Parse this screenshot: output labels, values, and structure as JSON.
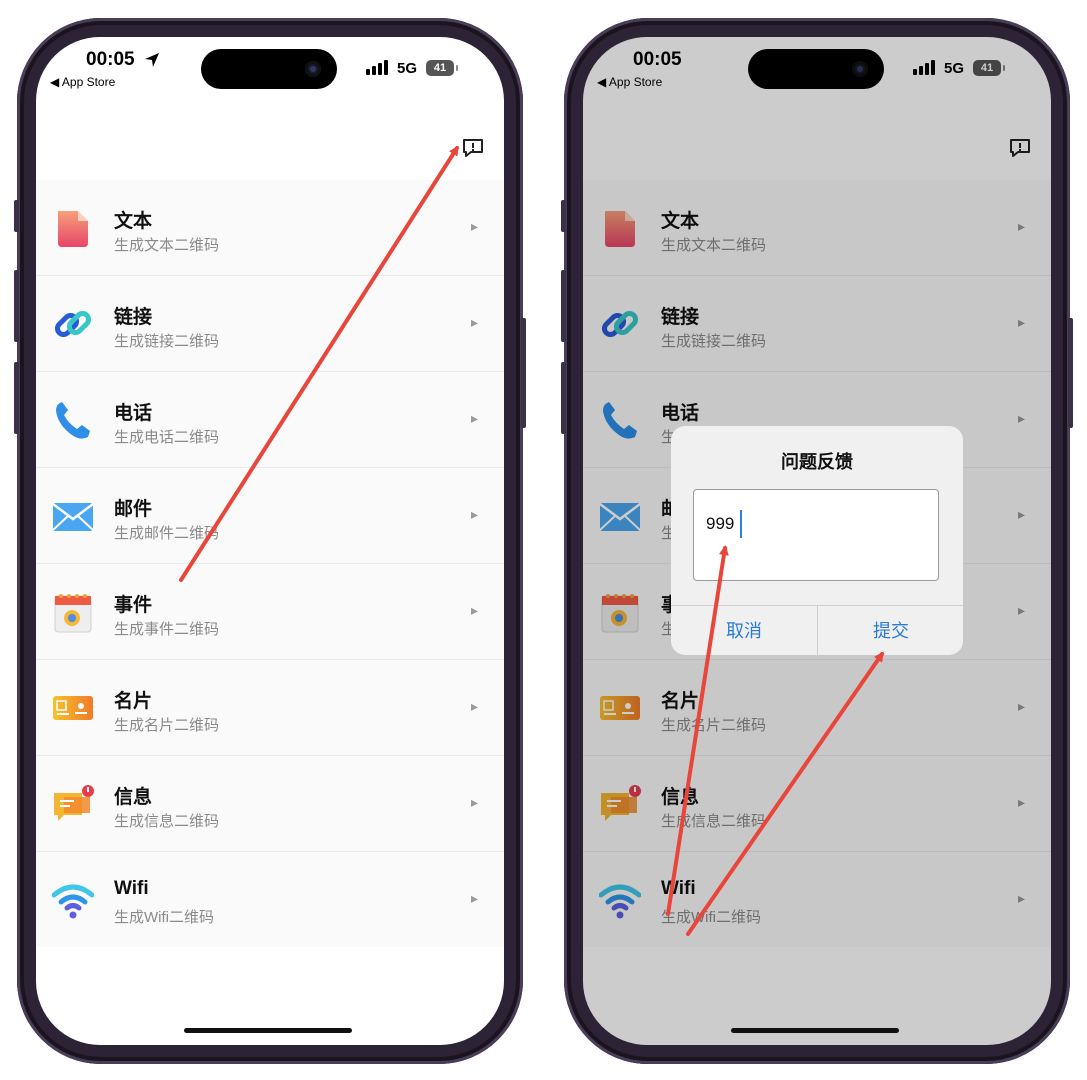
{
  "status_bar": {
    "time": "00:05",
    "back_app": "◀ App Store",
    "network": "5G",
    "battery": "41"
  },
  "list_items": [
    {
      "title": "文本",
      "subtitle": "生成文本二维码",
      "icon": "document-icon"
    },
    {
      "title": "链接",
      "subtitle": "生成链接二维码",
      "icon": "link-icon"
    },
    {
      "title": "电话",
      "subtitle": "生成电话二维码",
      "icon": "phone-icon"
    },
    {
      "title": "邮件",
      "subtitle": "生成邮件二维码",
      "icon": "mail-icon"
    },
    {
      "title": "事件",
      "subtitle": "生成事件二维码",
      "icon": "calendar-icon"
    },
    {
      "title": "名片",
      "subtitle": "生成名片二维码",
      "icon": "business-card-icon"
    },
    {
      "title": "信息",
      "subtitle": "生成信息二维码",
      "icon": "message-icon"
    },
    {
      "title": "Wifi",
      "subtitle": "生成Wifi二维码",
      "icon": "wifi-icon"
    }
  ],
  "dialog": {
    "title": "问题反馈",
    "input_value": "999",
    "cancel_label": "取消",
    "submit_label": "提交"
  },
  "colors": {
    "annotation_arrow": "#e8463a",
    "dialog_button": "#2a7ad8",
    "phone_frame": "#2c2336"
  }
}
